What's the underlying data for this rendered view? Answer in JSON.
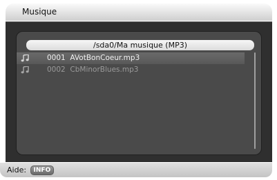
{
  "window": {
    "title": "Musique"
  },
  "browser": {
    "path": "/sda0/Ma musique (MP3)",
    "files": [
      {
        "number": "0001",
        "name": "AVotBonCoeur.mp3",
        "icon": "music-note-icon",
        "selected": true
      },
      {
        "number": "0002",
        "name": "CbMinorBlues.mp3",
        "icon": "music-note-icon",
        "selected": false
      }
    ]
  },
  "help": {
    "label": "Aide:",
    "key": "INFO"
  },
  "colors": {
    "frame": "#2f2f2f",
    "panel": "#4a4a4a",
    "selected_row": "#606060",
    "text_selected": "#f2f2f2",
    "text_normal": "#9a9a9a"
  }
}
